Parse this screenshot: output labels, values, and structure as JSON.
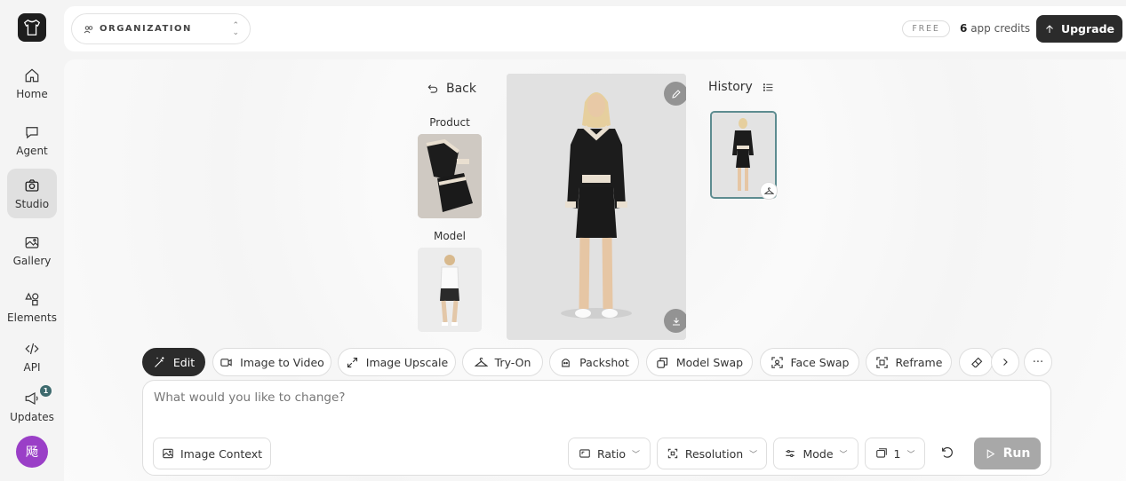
{
  "sidebar": {
    "items": [
      {
        "label": "Home",
        "icon": "home-icon"
      },
      {
        "label": "Agent",
        "icon": "chat-icon"
      },
      {
        "label": "Studio",
        "icon": "camera-icon",
        "active": true
      },
      {
        "label": "Gallery",
        "icon": "gallery-icon"
      },
      {
        "label": "Elements",
        "icon": "elements-icon"
      },
      {
        "label": "API",
        "icon": "code-icon"
      },
      {
        "label": "Updates",
        "icon": "megaphone-icon",
        "badge": "1"
      }
    ],
    "avatar_initial": "飏"
  },
  "topbar": {
    "organization_label": "ORGANIZATION",
    "plan_badge": "FREE",
    "credits_count": "6",
    "credits_label": "app credits",
    "upgrade_label": "Upgrade"
  },
  "studio": {
    "back_label": "Back",
    "product_label": "Product",
    "model_label": "Model",
    "history_label": "History"
  },
  "toolbar": {
    "tools": [
      {
        "label": "Edit",
        "icon": "magic-wand-icon",
        "active": true
      },
      {
        "label": "Image to Video",
        "icon": "video-icon"
      },
      {
        "label": "Image Upscale",
        "icon": "expand-icon"
      },
      {
        "label": "Try-On",
        "icon": "hanger-icon"
      },
      {
        "label": "Packshot",
        "icon": "packshot-icon"
      },
      {
        "label": "Model Swap",
        "icon": "swap-icon"
      },
      {
        "label": "Face Swap",
        "icon": "face-scan-icon"
      },
      {
        "label": "Reframe",
        "icon": "reframe-icon"
      }
    ]
  },
  "prompt": {
    "placeholder": "What would you like to change?",
    "image_context_label": "Image Context",
    "ratio_label": "Ratio",
    "resolution_label": "Resolution",
    "mode_label": "Mode",
    "count_value": "1",
    "run_label": "Run"
  },
  "colors": {
    "accent_dark": "#2b2b2b",
    "history_border": "#5d8c90",
    "avatar_bg": "#9a3fc7",
    "run_disabled": "#a8a8a8"
  }
}
